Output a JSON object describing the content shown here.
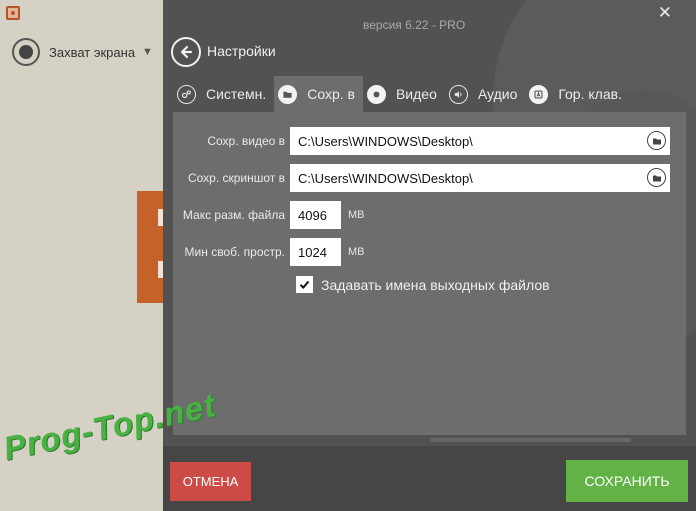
{
  "background_app": {
    "capture_label": "Захват экрана"
  },
  "dialog": {
    "version": "версия 6.22 - PRO",
    "title": "Настройки",
    "tabs": [
      {
        "label": "Системн.",
        "icon": "gears-icon"
      },
      {
        "label": "Сохр. в",
        "icon": "folder-icon"
      },
      {
        "label": "Видео",
        "icon": "record-icon"
      },
      {
        "label": "Аудио",
        "icon": "speaker-icon"
      },
      {
        "label": "Гор. клав.",
        "icon": "hotkey-icon"
      }
    ],
    "active_tab": "Сохр. в",
    "fields": {
      "video_path_label": "Сохр. видео в",
      "video_path_value": "C:\\Users\\WINDOWS\\Desktop\\",
      "screenshot_path_label": "Сохр. скриншот в",
      "screenshot_path_value": "C:\\Users\\WINDOWS\\Desktop\\",
      "max_file_size_label": "Макс разм. файла",
      "max_file_size_value": "4096",
      "max_file_size_unit": "MB",
      "min_free_space_label": "Мин своб. простр.",
      "min_free_space_value": "1024",
      "min_free_space_unit": "MB",
      "name_files_label": "Задавать имена выходных файлов",
      "name_files_checked": true
    },
    "buttons": {
      "cancel": "ОТМЕНА",
      "save": "СОХРАНИТЬ"
    }
  },
  "watermark": "Prog-Top.net",
  "colors": {
    "dialog_bg": "#525252",
    "panel_bg": "#6d6d6d",
    "cancel": "#cd4b47",
    "save": "#62b246",
    "accent_orange": "#c5622a"
  }
}
